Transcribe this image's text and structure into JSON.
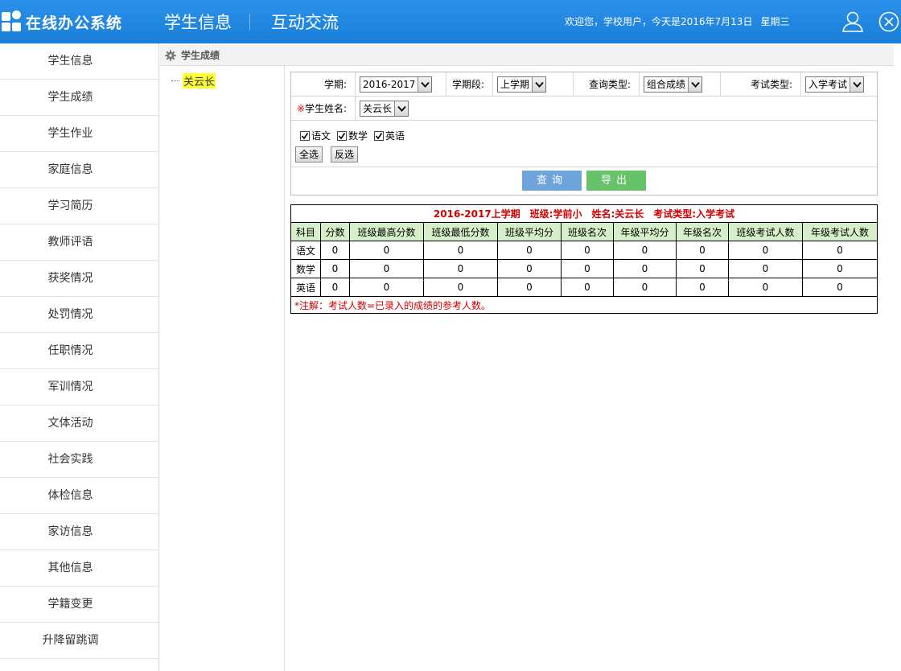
{
  "header": {
    "app_title": "在线办公系统",
    "nav": [
      "学生信息",
      "互动交流"
    ],
    "welcome_parts": [
      "欢迎您，学校用户，今天是2016年7月13日",
      "星期三"
    ]
  },
  "sidebar": {
    "items": [
      "学生信息",
      "学生成绩",
      "学生作业",
      "家庭信息",
      "学习简历",
      "教师评语",
      "获奖情况",
      "处罚情况",
      "任职情况",
      "军训情况",
      "文体活动",
      "社会实践",
      "体检信息",
      "家访信息",
      "其他信息",
      "学籍变更",
      "升降留跳调"
    ]
  },
  "breadcrumb": {
    "title": "学生成绩"
  },
  "tree": {
    "selected": "关云长"
  },
  "query": {
    "term_label": "学期:",
    "term_value": "2016-2017",
    "period_label": "学期段:",
    "period_value": "上学期",
    "query_type_label": "查询类型:",
    "query_type_value": "组合成绩",
    "exam_type_label": "考试类型:",
    "exam_type_value": "入学考试",
    "required_mark": "※",
    "student_label": "学生姓名:",
    "student_value": "关云长",
    "subjects": [
      {
        "label": "语文",
        "checked": true
      },
      {
        "label": "数学",
        "checked": true
      },
      {
        "label": "英语",
        "checked": true
      }
    ],
    "select_all": "全选",
    "invert": "反选",
    "query_btn": "查询",
    "export_btn": "导出"
  },
  "result": {
    "caption_parts": [
      "2016-2017上学期",
      "班级:学前小",
      "姓名:关云长",
      "考试类型:入学考试"
    ],
    "columns": [
      "科目",
      "分数",
      "班级最高分数",
      "班级最低分数",
      "班级平均分",
      "班级名次",
      "年级平均分",
      "年级名次",
      "班级考试人数",
      "年级考试人数"
    ],
    "rows": [
      [
        "语文",
        "0",
        "0",
        "0",
        "0",
        "0",
        "0",
        "0",
        "0",
        "0"
      ],
      [
        "数学",
        "0",
        "0",
        "0",
        "0",
        "0",
        "0",
        "0",
        "0",
        "0"
      ],
      [
        "英语",
        "0",
        "0",
        "0",
        "0",
        "0",
        "0",
        "0",
        "0",
        "0"
      ]
    ],
    "note": "*注解：考试人数=已录入的成绩的参考人数。"
  },
  "colors": {
    "header_blue": "#1a7fd9",
    "header_row_green": "#d5f0c9",
    "highlight_red": "#d20000",
    "query_button": "#6ea4dc",
    "export_button": "#66c36a"
  }
}
